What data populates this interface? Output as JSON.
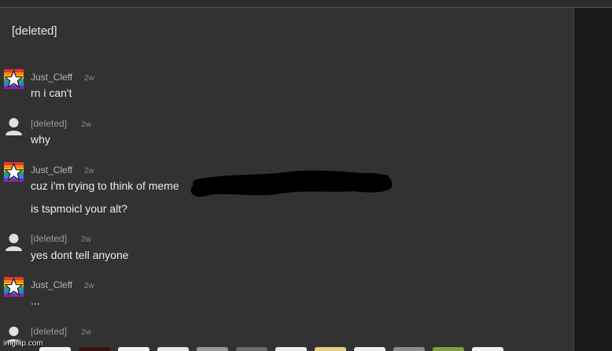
{
  "parent": {
    "author": "[deleted]"
  },
  "comments": [
    {
      "author": "Just_Cleff",
      "time": "2w",
      "lines": [
        "rn i can't"
      ]
    },
    {
      "author": "[deleted]",
      "time": "2w",
      "lines": [
        "why"
      ]
    },
    {
      "author": "Just_Cleff",
      "time": "2w",
      "lines": [
        "cuz i'm trying to think of meme",
        "is tspmoicl your alt?"
      ]
    },
    {
      "author": "[deleted]",
      "time": "2w",
      "lines": [
        "yes dont tell anyone"
      ]
    },
    {
      "author": "Just_Cleff",
      "time": "2w",
      "lines": [
        "..."
      ]
    },
    {
      "author": "[deleted]",
      "time": "2w",
      "lines": []
    }
  ],
  "icons": {
    "user_avatar": "rainbow-star-avatar-icon",
    "deleted_avatar": "default-user-avatar-icon"
  },
  "colors": {
    "background": "#323232",
    "side_panel": "#1a1a1a",
    "username": "#b7b7b7",
    "text": "#ececec"
  },
  "watermark": "imgflip.com"
}
